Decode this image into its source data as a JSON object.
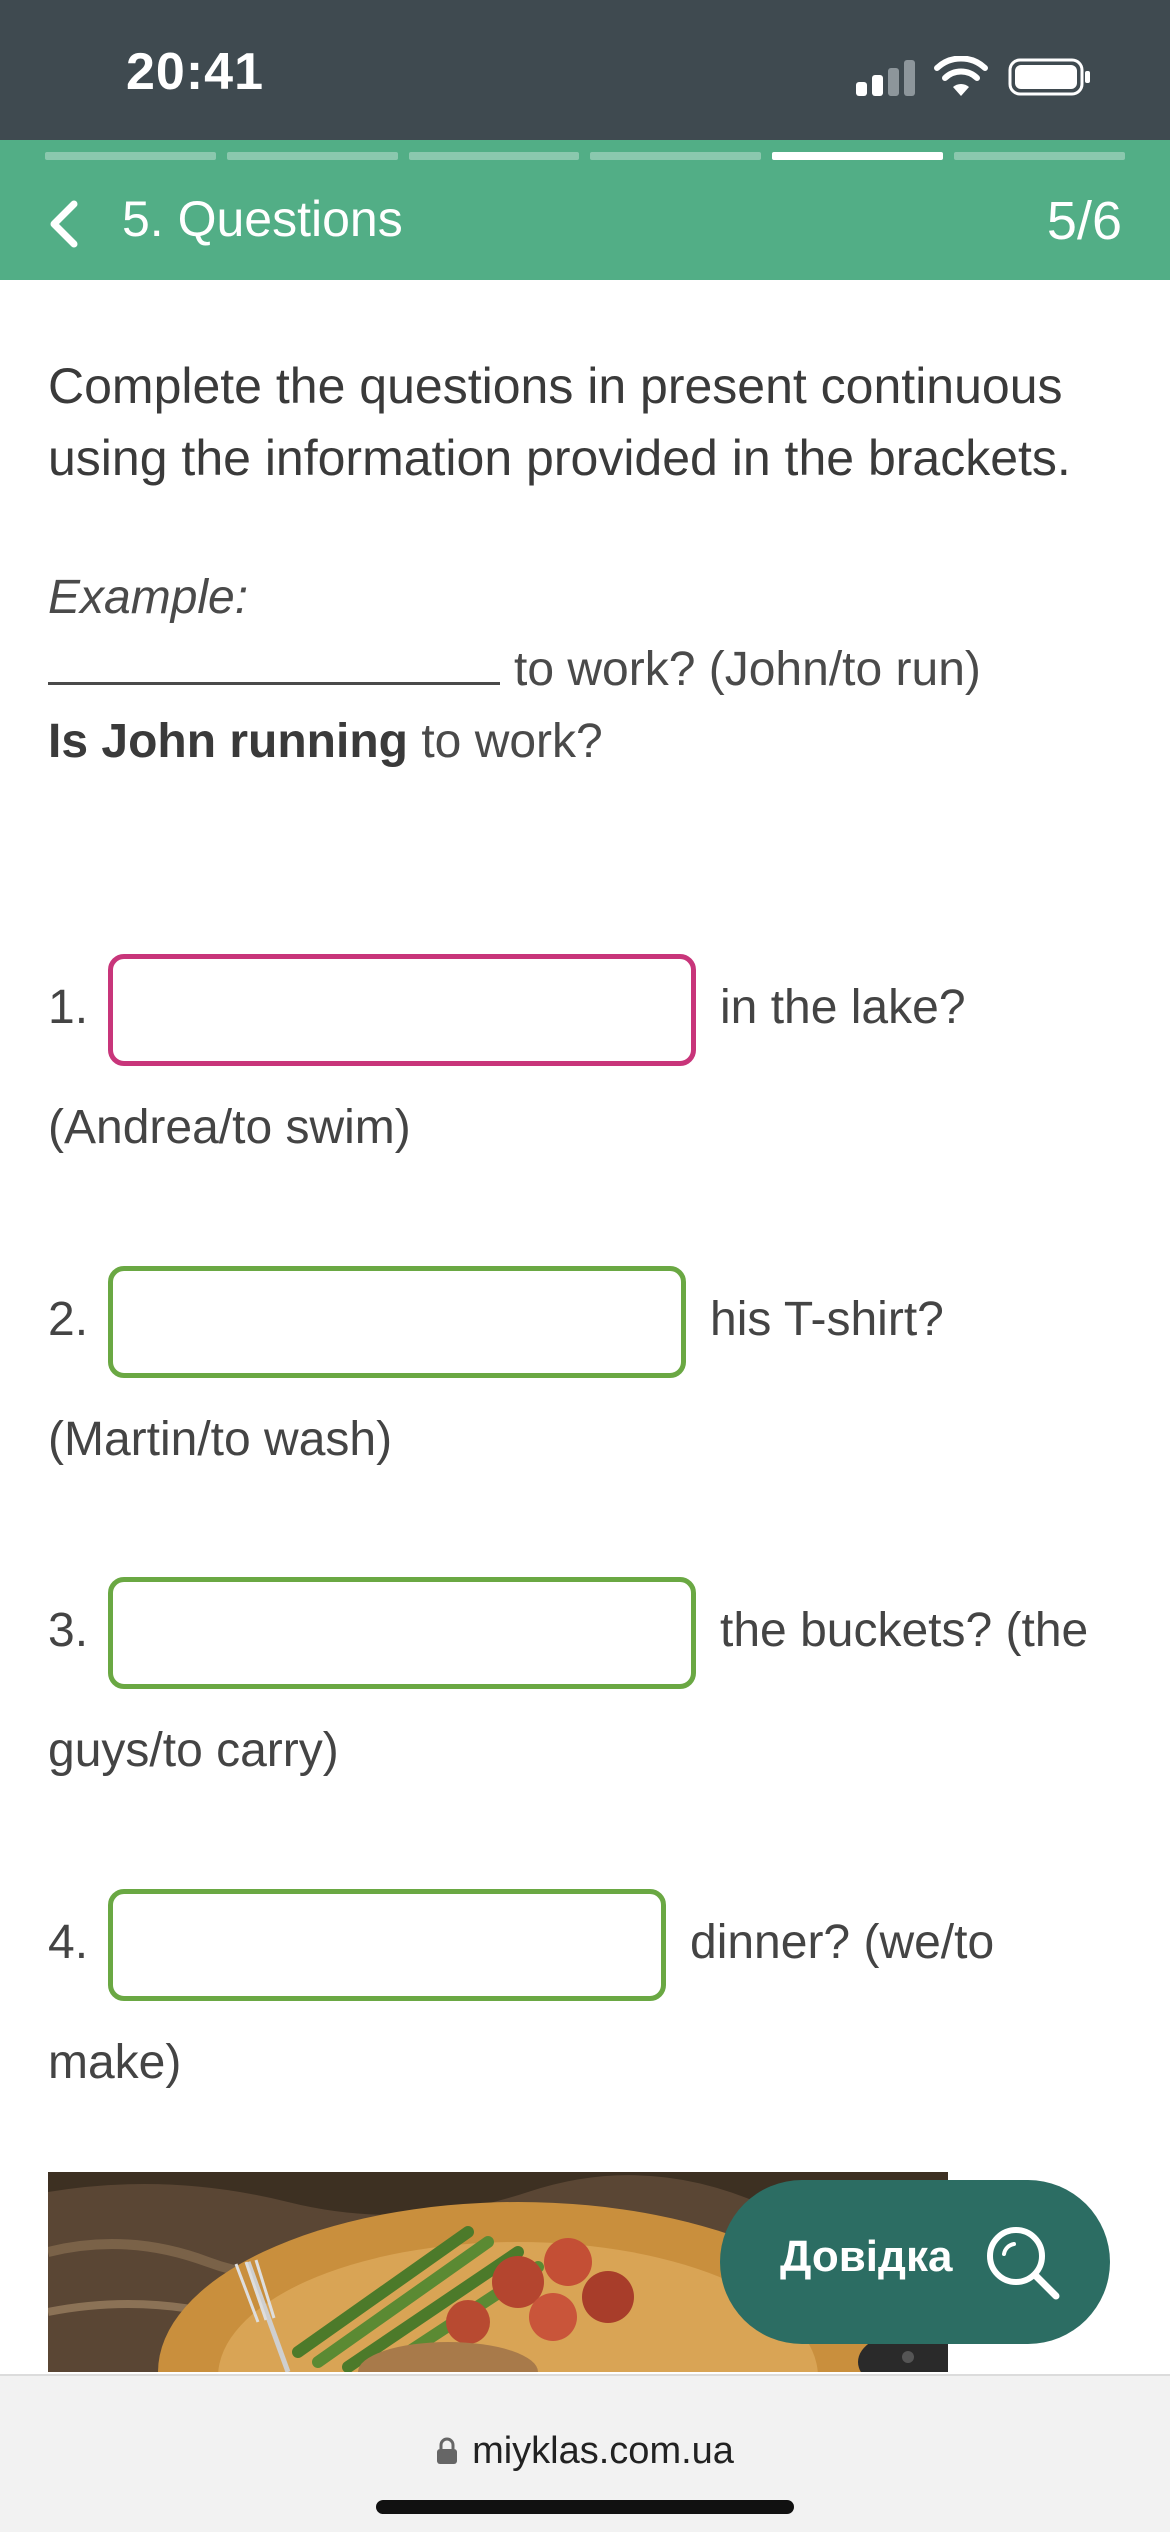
{
  "status": {
    "time": "20:41"
  },
  "header": {
    "title": "5. Questions",
    "count": "5/6",
    "progress": {
      "total": 6,
      "current": 5
    },
    "color": "#52ae86"
  },
  "instructions": "Complete the questions in present continuous using the information provided in the brackets.",
  "example": {
    "label": "Example:",
    "question_tail": "to work? (John/to run)",
    "answer_bold": "Is John running",
    "answer_tail": " to work?"
  },
  "questions": [
    {
      "num": "1.",
      "after": "in the lake?",
      "hint": "(Andrea/to swim)",
      "value": "",
      "focused": true
    },
    {
      "num": "2.",
      "after": "his T-shirt?",
      "hint": "(Martin/to wash)",
      "value": "",
      "focused": false
    },
    {
      "num": "3.",
      "after": "the buckets? (the",
      "hint": "guys/to carry)",
      "value": "",
      "focused": false
    },
    {
      "num": "4.",
      "after": "dinner? (we/to",
      "hint": "make)",
      "value": "",
      "focused": false
    }
  ],
  "help": {
    "label": "Довідка",
    "icon": "search-icon",
    "color": "#2c6d63"
  },
  "browser": {
    "url": "miyklas.com.ua"
  },
  "colors": {
    "focus_border": "#c8357a",
    "input_border": "#6aa843",
    "status_bar": "#3f4a50"
  }
}
